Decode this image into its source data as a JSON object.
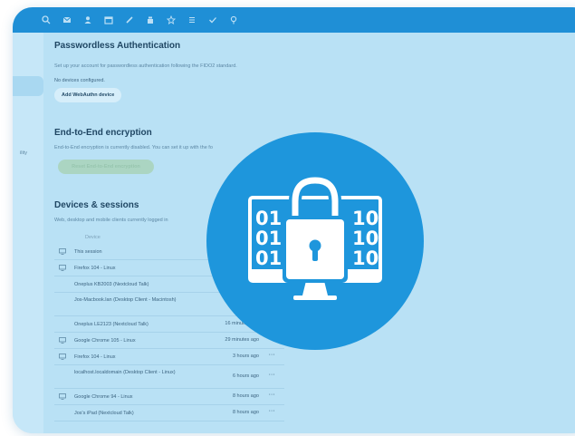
{
  "toolbar": {
    "icons": [
      "search-icon",
      "mail-icon",
      "contacts-icon",
      "calendar-icon",
      "pencil-icon",
      "deck-icon",
      "star-icon",
      "list-icon",
      "check-icon",
      "location-icon"
    ]
  },
  "sidebar": {
    "partial_label": "ility"
  },
  "passwordless": {
    "title": "Passwordless Authentication",
    "description": "Set up your account for passwordless authentication following the FIDO2 standard.",
    "status": "No devices configured.",
    "button": "Add WebAuthn device"
  },
  "e2e": {
    "title": "End-to-End encryption",
    "description": "End-to-End encryption is currently disabled. You can set it up with the fo",
    "button": "Reset End-to-End encryption"
  },
  "devices": {
    "title": "Devices & sessions",
    "description": "Web, desktop and mobile clients currently logged in",
    "column_device": "Device",
    "rows": [
      {
        "name": "This session",
        "last": "",
        "icon": true,
        "more": false
      },
      {
        "name": "Firefox 104 - Linux",
        "last": "",
        "icon": true,
        "more": false
      },
      {
        "name": "Oneplus KB2003 (Nextcloud Talk)",
        "last": "",
        "icon": false,
        "more": false
      },
      {
        "name": "Jos-Macbook.lan (Desktop Client - Macintosh)",
        "last": "",
        "icon": false,
        "more": false
      },
      {
        "name": "Oneplus LE2123 (Nextcloud Talk)",
        "last": "16 minutes ago",
        "icon": false,
        "more": false
      },
      {
        "name": "Google Chrome 105 - Linux",
        "last": "29 minutes ago",
        "icon": true,
        "more": true
      },
      {
        "name": "Firefox 104 - Linux",
        "last": "3 hours ago",
        "icon": true,
        "more": true
      },
      {
        "name": "localhost.localdomain (Desktop Client - Linux)",
        "last": "6 hours ago",
        "icon": false,
        "more": true
      },
      {
        "name": "Google Chrome 94 - Linux",
        "last": "8 hours ago",
        "icon": true,
        "more": true
      },
      {
        "name": "Jos's iPad (Nextcloud Talk)",
        "last": "8 hours ago",
        "icon": false,
        "more": true
      }
    ],
    "more_label": "···"
  },
  "badge": {
    "binary_left": [
      "01",
      "01",
      "01"
    ],
    "binary_right": [
      "10",
      "10",
      "10"
    ],
    "color": "#1e96dc"
  }
}
